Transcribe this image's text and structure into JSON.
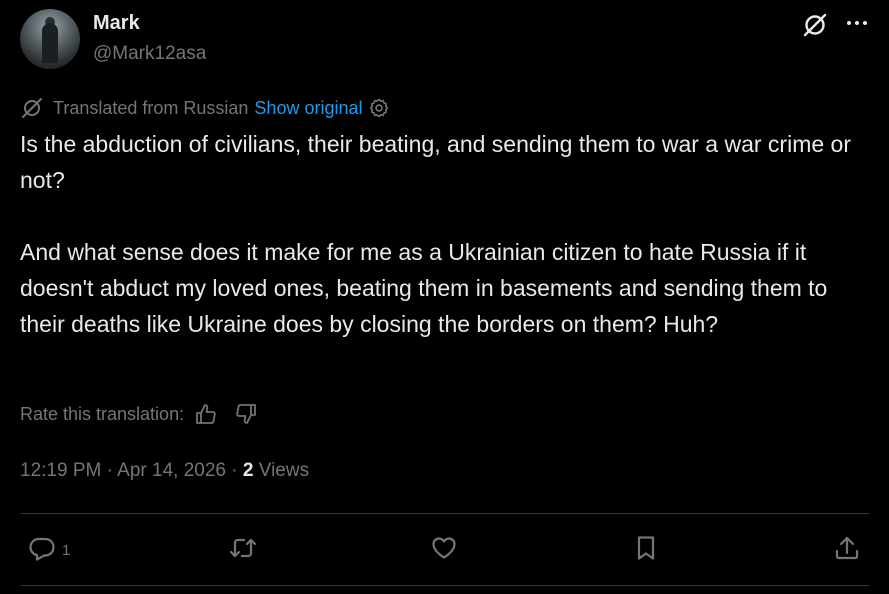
{
  "author": {
    "display_name": "Mark",
    "handle": "@Mark12asa"
  },
  "translation": {
    "label": "Translated from Russian",
    "show_original": "Show original"
  },
  "tweet": {
    "paragraph_1": "Is the abduction of civilians, their beating, and sending them to war a war crime or not?",
    "paragraph_2": "And what sense does it make for me as a Ukrainian citizen to hate Russia if it doesn't abduct my loved ones, beating them in basements and sending them to their deaths like Ukraine does by closing the borders on them? Huh?"
  },
  "rating": {
    "label": "Rate this translation:"
  },
  "meta": {
    "time": "12:19 PM",
    "separator": "·",
    "date": "Apr 14, 2026",
    "views_count": "2",
    "views_label": "Views"
  },
  "actions": {
    "reply_count": "1"
  },
  "icons": {
    "grok": "grok-icon",
    "more": "more-icon",
    "translate": "translate-icon",
    "settings": "gear-icon",
    "thumbs_up": "thumbs-up-icon",
    "thumbs_down": "thumbs-down-icon",
    "reply": "reply-icon",
    "retweet": "retweet-icon",
    "like": "heart-icon",
    "bookmark": "bookmark-icon",
    "share": "share-icon"
  },
  "colors": {
    "background": "#000000",
    "text": "#e7e9ea",
    "muted": "#71767b",
    "link": "#1d9bf0",
    "divider": "#2f3336"
  }
}
